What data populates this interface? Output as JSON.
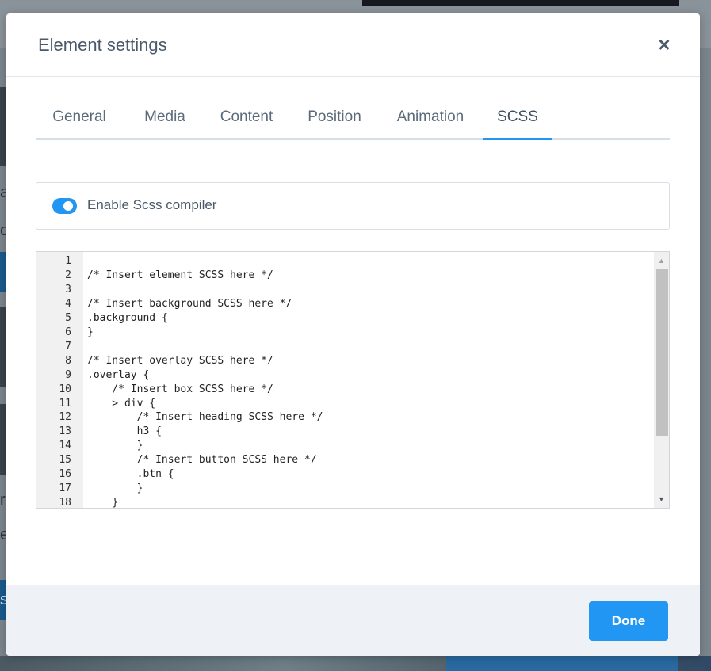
{
  "modal": {
    "title": "Element settings",
    "close_glyph": "×"
  },
  "tabs": [
    {
      "label": "General",
      "active": false
    },
    {
      "label": "Media",
      "active": false
    },
    {
      "label": "Content",
      "active": false
    },
    {
      "label": "Position",
      "active": false
    },
    {
      "label": "Animation",
      "active": false
    },
    {
      "label": "SCSS",
      "active": true
    }
  ],
  "scss_toggle": {
    "label": "Enable Scss compiler",
    "enabled": true
  },
  "editor": {
    "lines": [
      {
        "no": "1",
        "code": ""
      },
      {
        "no": "2",
        "code": "/* Insert element SCSS here */"
      },
      {
        "no": "3",
        "code": ""
      },
      {
        "no": "4",
        "code": "/* Insert background SCSS here */"
      },
      {
        "no": "5",
        "code": ".background {"
      },
      {
        "no": "6",
        "code": "}"
      },
      {
        "no": "7",
        "code": ""
      },
      {
        "no": "8",
        "code": "/* Insert overlay SCSS here */"
      },
      {
        "no": "9",
        "code": ".overlay {"
      },
      {
        "no": "10",
        "code": "    /* Insert box SCSS here */"
      },
      {
        "no": "11",
        "code": "    > div {"
      },
      {
        "no": "12",
        "code": "        /* Insert heading SCSS here */"
      },
      {
        "no": "13",
        "code": "        h3 {"
      },
      {
        "no": "14",
        "code": "        }"
      },
      {
        "no": "15",
        "code": "        /* Insert button SCSS here */"
      },
      {
        "no": "16",
        "code": "        .btn {"
      },
      {
        "no": "17",
        "code": "        }"
      },
      {
        "no": "18",
        "code": "    }"
      }
    ],
    "scroll_up_glyph": "▲",
    "scroll_down_glyph": "▼"
  },
  "footer": {
    "done_label": "Done"
  },
  "background_page": {
    "edge_letters": [
      "a",
      "o",
      "r",
      "e",
      "s"
    ]
  },
  "colors": {
    "accent": "#2196f3",
    "footer_bg": "#eef1f5",
    "text": "#4a5a6a"
  }
}
